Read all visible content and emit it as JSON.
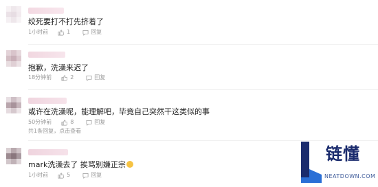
{
  "comments": [
    {
      "text": "绞死要打不打先挤着了",
      "time": "1小时前",
      "likes": "1",
      "reply_label": "回复",
      "sub_text": "",
      "emoji_icon": ""
    },
    {
      "text": "抱歉，洗澡来迟了",
      "time": "18分钟前",
      "likes": "2",
      "reply_label": "回复",
      "sub_text": "",
      "emoji_icon": ""
    },
    {
      "text": "或许在洗澡呢，能理解吧，毕竟自己突然干这类似的事",
      "time": "50分钟前",
      "likes": "8",
      "reply_label": "回复",
      "sub_text": "共1条回复，点击查看",
      "emoji_icon": ""
    },
    {
      "text": "mark洗澡去了 挨骂别嫌正宗",
      "time": "1小时前",
      "likes": "5",
      "reply_label": "回复",
      "sub_text": "",
      "emoji_icon": "laugh-emoji-icon"
    }
  ],
  "watermark": {
    "title": "链懂",
    "url": "NEATDOWN.COM",
    "colors": {
      "navy": "#1a2b6d",
      "blue": "#2a6fd6"
    }
  },
  "colors": {
    "meta": "#999999",
    "text": "#222222"
  }
}
